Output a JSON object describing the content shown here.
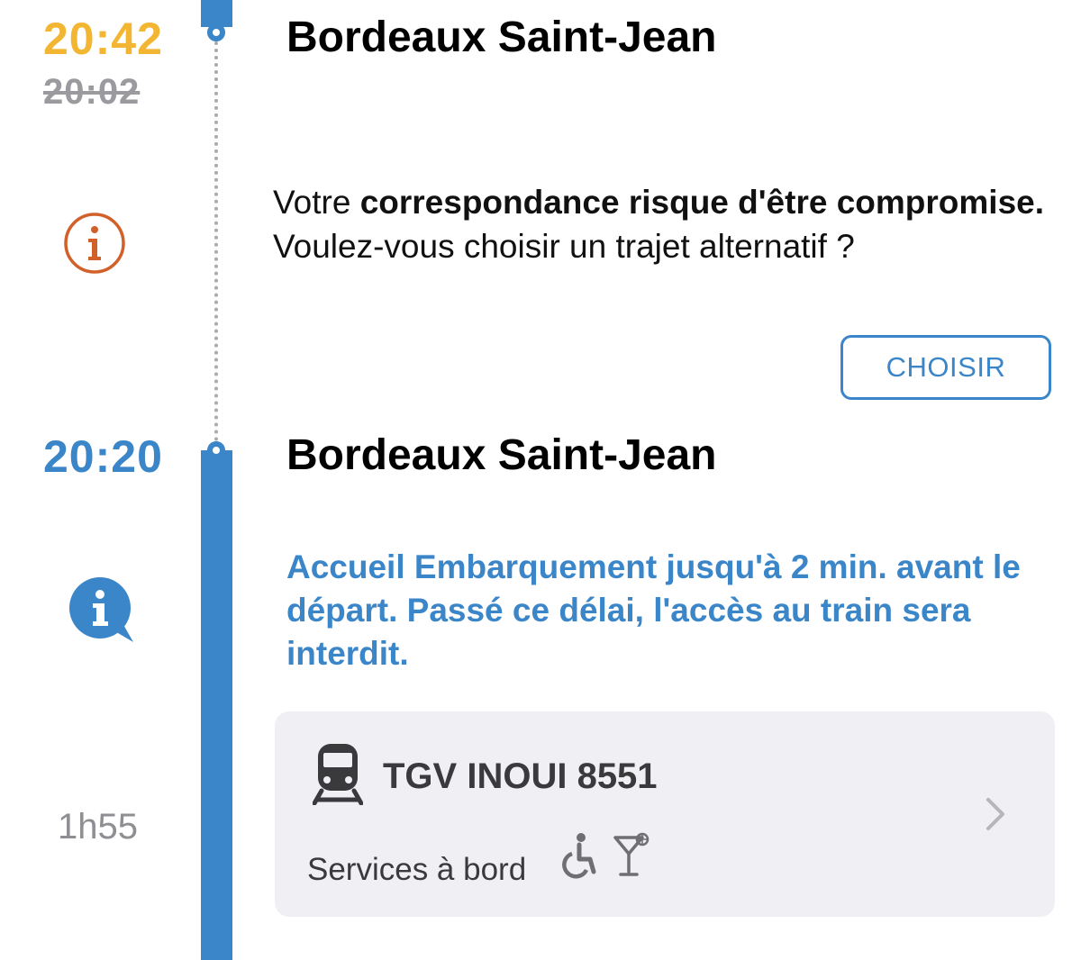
{
  "first_stop": {
    "time_new": "20:42",
    "time_old": "20:02",
    "station": "Bordeaux Saint-Jean",
    "time_color": "#f2b632"
  },
  "connection_alert": {
    "icon": "info-circle-outline-icon",
    "text_1": "Votre ",
    "text_bold": "correspondance risque d'être compromise.",
    "text_2": " Voulez-vous choisir un trajet alternatif ?",
    "button_label": "CHOISIR",
    "icon_color": "#d2602a"
  },
  "second_stop": {
    "time": "20:20",
    "station": "Bordeaux Saint-Jean",
    "time_color": "#3b86c8"
  },
  "boarding_info": {
    "icon": "info-speech-bubble-icon",
    "text": "Accueil Embarquement jusqu'à 2 min. avant le départ. Passé ce délai, l'accès au train sera interdit."
  },
  "train_card": {
    "icon": "train-icon",
    "name": "TGV INOUI 8551",
    "services_label": "Services à bord",
    "service_icons": [
      "wheelchair-icon",
      "cocktail-icon"
    ],
    "chevron": "chevron-right-icon"
  },
  "duration": "1h55",
  "accent_color": "#3b86c8"
}
